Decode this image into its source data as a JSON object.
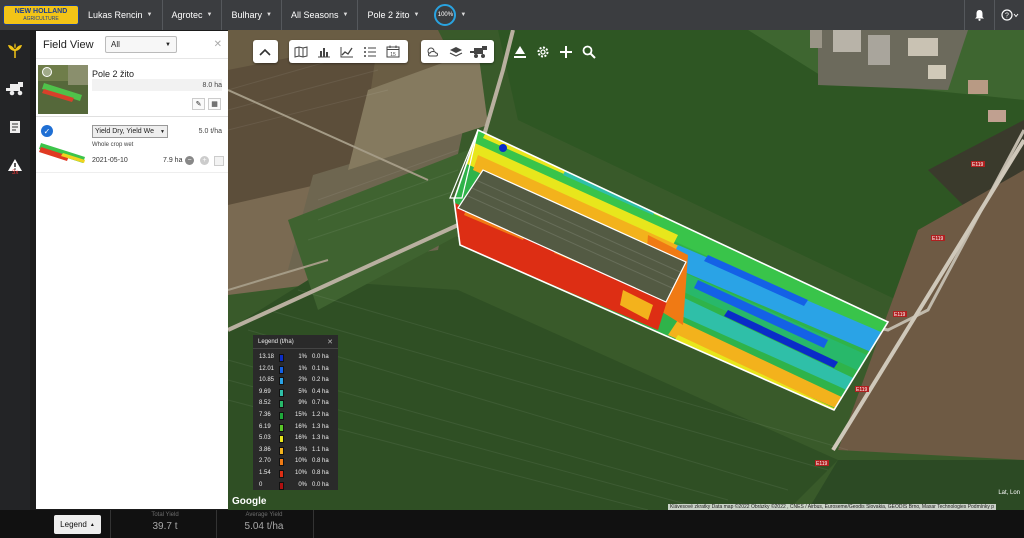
{
  "brand": {
    "line1": "NEW HOLLAND",
    "line2": "AGRICULTURE"
  },
  "breadcrumbs": [
    {
      "label": "Lukas Rencin"
    },
    {
      "label": "Agrotec"
    },
    {
      "label": "Bulhary"
    },
    {
      "label": "All Seasons"
    },
    {
      "label": "Pole 2 žito"
    }
  ],
  "progress": {
    "label": "100%",
    "value": 100
  },
  "top_right_icons": [
    "bell-icon",
    "help-icon"
  ],
  "rail": {
    "items": [
      "wheat-icon",
      "combine-icon",
      "document-icon",
      "alert-icon"
    ],
    "alert_count": "3x"
  },
  "panel": {
    "title": "Field View",
    "view_select": "All",
    "field": {
      "name": "Pole 2 žito",
      "area": "8.0 ha"
    },
    "layer": {
      "type": "Yield Dry, Yield We",
      "rate": "5.0 t/ha",
      "description": "Whole crop wet",
      "date": "2021-05-10",
      "area": "7.9 ha"
    }
  },
  "colors": {
    "topbar": "#3b3d40",
    "accent": "#29a3e0",
    "brand_yellow": "#f2c417"
  },
  "legend": {
    "title": "Legend (t/ha)",
    "rows": [
      {
        "value": "13.18",
        "color": "#0a2cc8",
        "pct": "1%",
        "area": "0.0 ha"
      },
      {
        "value": "12.01",
        "color": "#1461e6",
        "pct": "1%",
        "area": "0.1 ha"
      },
      {
        "value": "10.85",
        "color": "#2aa3e6",
        "pct": "2%",
        "area": "0.2 ha"
      },
      {
        "value": "9.69",
        "color": "#2fbfa8",
        "pct": "5%",
        "area": "0.4 ha"
      },
      {
        "value": "8.52",
        "color": "#28b86a",
        "pct": "9%",
        "area": "0.7 ha"
      },
      {
        "value": "7.36",
        "color": "#1ea83a",
        "pct": "15%",
        "area": "1.2 ha"
      },
      {
        "value": "6.19",
        "color": "#5ac828",
        "pct": "16%",
        "area": "1.3 ha"
      },
      {
        "value": "5.03",
        "color": "#e8e61c",
        "pct": "16%",
        "area": "1.3 ha"
      },
      {
        "value": "3.86",
        "color": "#f3b21c",
        "pct": "13%",
        "area": "1.1 ha"
      },
      {
        "value": "2.70",
        "color": "#f07a14",
        "pct": "10%",
        "area": "0.8 ha"
      },
      {
        "value": "1.54",
        "color": "#dd2e14",
        "pct": "10%",
        "area": "0.8 ha"
      },
      {
        "value": "0",
        "color": "#b01010",
        "pct": "0%",
        "area": "0.0 ha"
      }
    ]
  },
  "map": {
    "google": "Google",
    "attribution": "Klávesové zkratky   Data map ©2022 Obrázky ©2022 , CNES / Airbus, Euroseme/Geodis Slovakia, GEODIS Brno, Maxar Technologies   Podmínky p",
    "latlon": "Lat, Lon",
    "road_labels": [
      "E119",
      "E119",
      "E119",
      "E119",
      "E119"
    ]
  },
  "bottom": {
    "legend_button": "Legend",
    "total_yield_label": "Total Yield",
    "total_yield_value": "39.7 t",
    "avg_yield_label": "Average Yield",
    "avg_yield_value": "5.04 t/ha"
  }
}
